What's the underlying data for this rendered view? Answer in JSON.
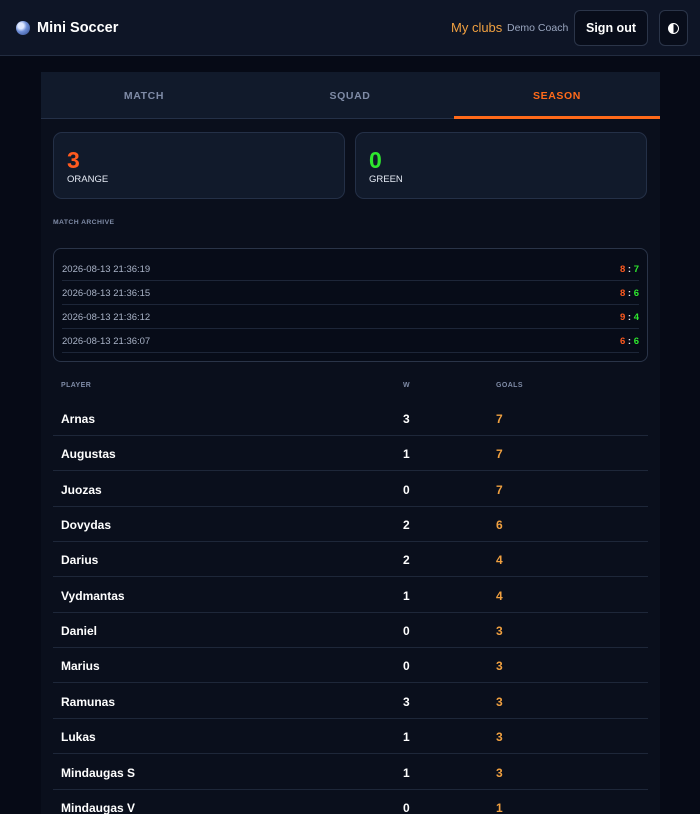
{
  "app": {
    "name": "Mini Soccer",
    "icon": "soccer-ball-icon"
  },
  "nav": {
    "clubs": "My clubs",
    "user": "Demo Coach",
    "signout": "Sign out",
    "theme_icon": "contrast-toggle-icon"
  },
  "colors": {
    "orange": "#ff5a1f",
    "green": "#2ee82e",
    "goals": "#f0a040",
    "accent": "#ff6a1a"
  },
  "tabs": [
    {
      "label": "MATCH",
      "active": false
    },
    {
      "label": "SQUAD",
      "active": false
    },
    {
      "label": "SEASON",
      "active": true
    }
  ],
  "season": {
    "orange": {
      "wins": "3",
      "label": "ORANGE"
    },
    "green": {
      "wins": "0",
      "label": "GREEN"
    }
  },
  "archive": {
    "title": "MATCH ARCHIVE",
    "matches": [
      {
        "date": "2026-08-13 21:36:19",
        "orange": "8",
        "green": "7"
      },
      {
        "date": "2026-08-13 21:36:15",
        "orange": "8",
        "green": "6"
      },
      {
        "date": "2026-08-13 21:36:12",
        "orange": "9",
        "green": "4"
      },
      {
        "date": "2026-08-13 21:36:07",
        "orange": "6",
        "green": "6"
      }
    ]
  },
  "stats": {
    "headers": {
      "player": "PLAYER",
      "wins": "W",
      "goals": "GOALS"
    },
    "players": [
      {
        "name": "Arnas",
        "w": "3",
        "goals": "7"
      },
      {
        "name": "Augustas",
        "w": "1",
        "goals": "7"
      },
      {
        "name": "Juozas",
        "w": "0",
        "goals": "7"
      },
      {
        "name": "Dovydas",
        "w": "2",
        "goals": "6"
      },
      {
        "name": "Darius",
        "w": "2",
        "goals": "4"
      },
      {
        "name": "Vydmantas",
        "w": "1",
        "goals": "4"
      },
      {
        "name": "Daniel",
        "w": "0",
        "goals": "3"
      },
      {
        "name": "Marius",
        "w": "0",
        "goals": "3"
      },
      {
        "name": "Ramunas",
        "w": "3",
        "goals": "3"
      },
      {
        "name": "Lukas",
        "w": "1",
        "goals": "3"
      },
      {
        "name": "Mindaugas S",
        "w": "1",
        "goals": "3"
      },
      {
        "name": "Mindaugas V",
        "w": "0",
        "goals": "1"
      }
    ]
  }
}
